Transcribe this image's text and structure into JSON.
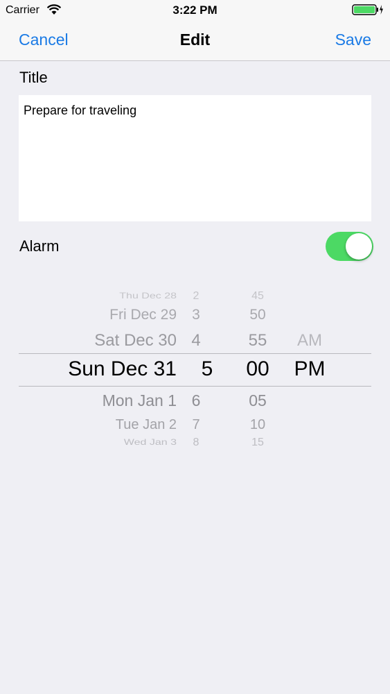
{
  "status_bar": {
    "carrier": "Carrier",
    "time": "3:22 PM"
  },
  "nav": {
    "cancel": "Cancel",
    "title": "Edit",
    "save": "Save"
  },
  "form": {
    "title_label": "Title",
    "title_value": "Prepare for traveling",
    "alarm_label": "Alarm",
    "alarm_on": true
  },
  "picker": {
    "dates": [
      "Thu Dec 28",
      "Fri Dec 29",
      "Sat Dec 30",
      "Sun Dec 31",
      "Mon Jan 1",
      "Tue Jan 2",
      "Wed Jan 3"
    ],
    "hours": [
      "2",
      "3",
      "4",
      "5",
      "6",
      "7",
      "8"
    ],
    "minutes": [
      "45",
      "50",
      "55",
      "00",
      "05",
      "10",
      "15"
    ],
    "ampm": [
      "AM",
      "PM"
    ],
    "selected": {
      "date": "Sun Dec 31",
      "hour": "5",
      "minute": "00",
      "ampm": "PM"
    }
  },
  "colors": {
    "accent": "#1a7ae5",
    "toggle_on": "#4cd964",
    "background": "#efeff4"
  }
}
